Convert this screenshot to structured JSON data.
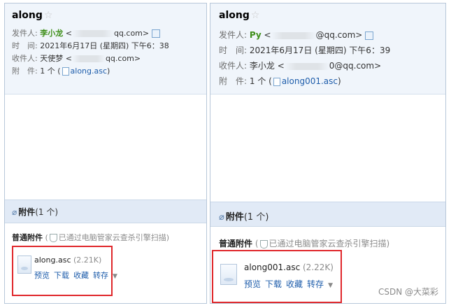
{
  "left": {
    "subject": "along",
    "from_label": "发件人:",
    "from_name": "李小龙",
    "from_open": " <",
    "from_email_tail": "qq.com>",
    "time_label": "时　间:",
    "time_value": "2021年6月17日 (星期四) 下午6：38",
    "to_label": "收件人:",
    "to_name": "天使梦",
    "to_open": " <",
    "to_email_tail": "qq.com>",
    "att_label": "附　件:",
    "att_count": "1 个 (",
    "att_file": "along.asc",
    "att_close": ")",
    "attbar_title": "附件",
    "attbar_count": "(1 个)",
    "normal_label": "普通附件",
    "scan_open": " (",
    "scan_text": "已通过电脑管家云查杀引擎扫描",
    "scan_close": ")",
    "file_name": "along.asc",
    "file_size": " (2.21K)",
    "actions": [
      "预览",
      "下载",
      "收藏",
      "转存"
    ]
  },
  "right": {
    "subject": "along",
    "from_label": "发件人:",
    "from_name": "Py",
    "from_open": " <",
    "from_email_tail": "@qq.com>",
    "time_label": "时　间:",
    "time_value": "2021年6月17日 (星期四) 下午6：39",
    "to_label": "收件人:",
    "to_name": "李小龙",
    "to_open": " <",
    "to_email_tail": "0@qq.com>",
    "att_label": "附　件:",
    "att_count": "1 个 (",
    "att_file": "along001.asc",
    "att_close": ")",
    "attbar_title": "附件",
    "attbar_count": "(1 个)",
    "normal_label": "普通附件",
    "scan_open": " (",
    "scan_text": "已通过电脑管家云查杀引擎扫描",
    "scan_close": ")",
    "file_name": "along001.asc",
    "file_size": " (2.22K)",
    "actions": [
      "预览",
      "下载",
      "收藏",
      "转存"
    ]
  },
  "watermark": "CSDN @大菜彩",
  "colors": {
    "highlight_border": "#e0272b",
    "sender_name": "#3f8f1a",
    "link": "#1e5dab",
    "attachment_bar": "#e1eaf6"
  }
}
